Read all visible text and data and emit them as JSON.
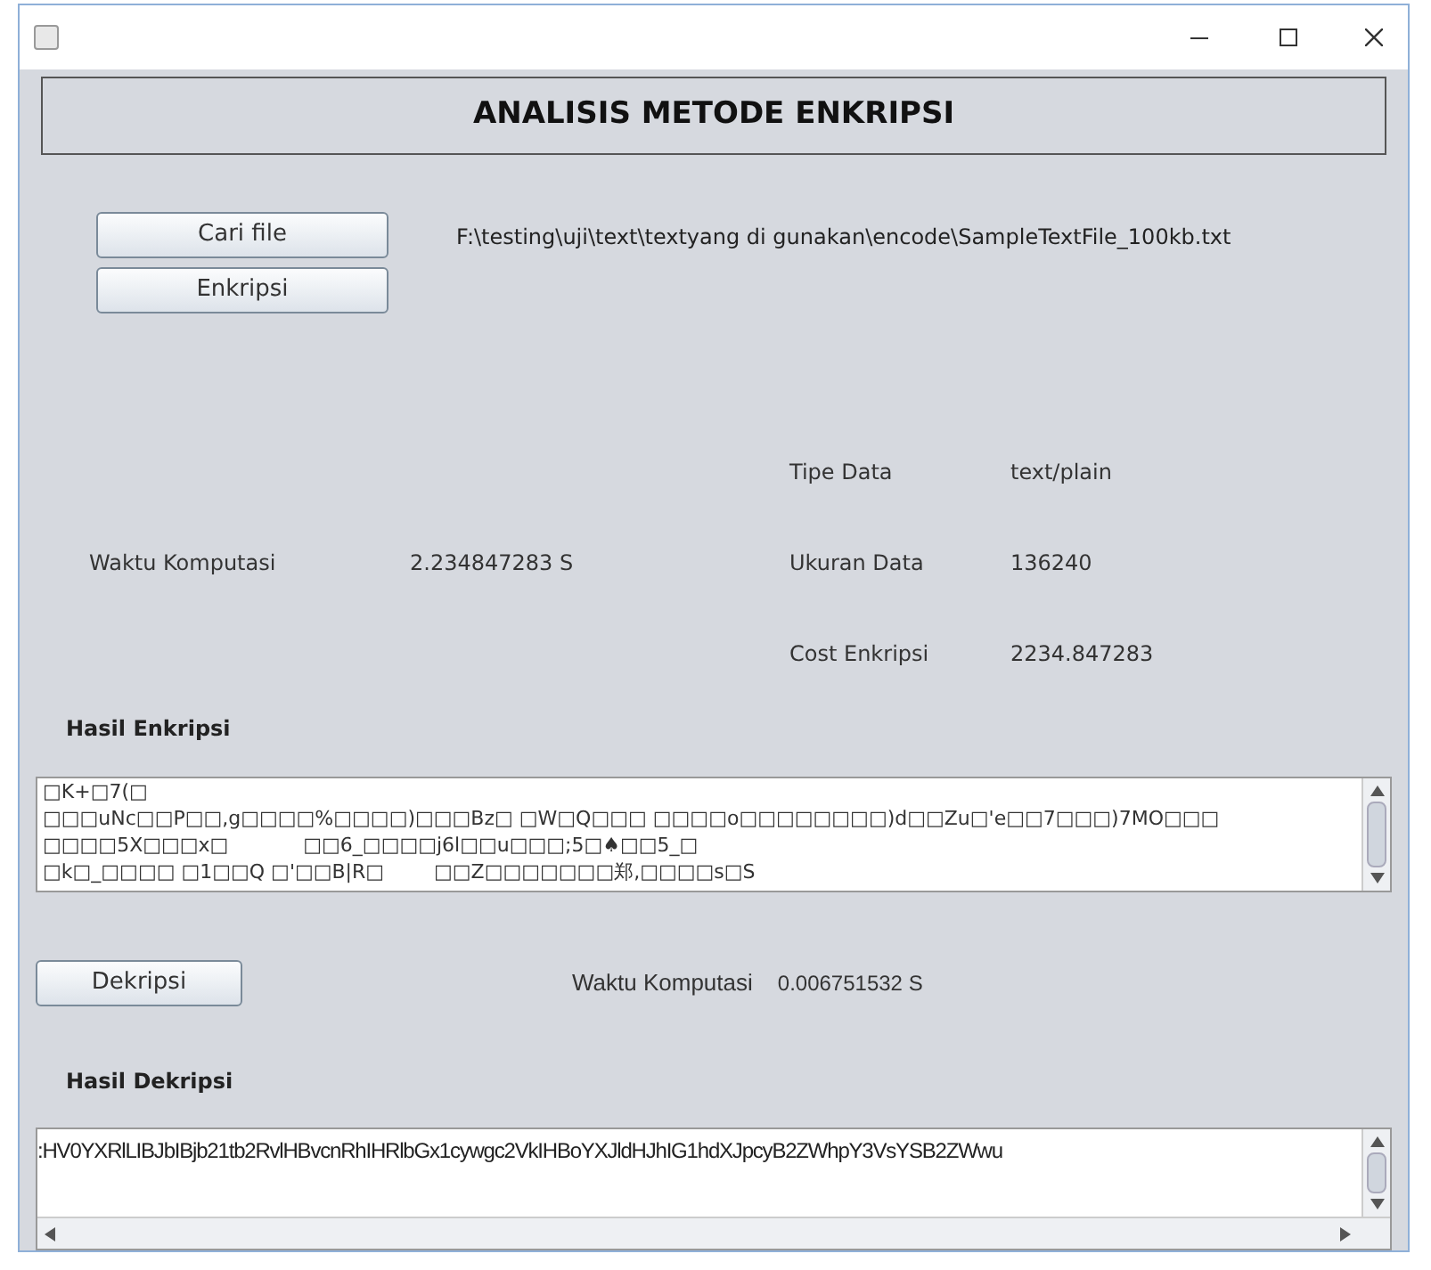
{
  "window": {
    "title_icon": true
  },
  "header": {
    "title": "ANALISIS METODE ENKRIPSI"
  },
  "buttons": {
    "open_file": "Cari file",
    "encrypt": "Enkripsi",
    "decrypt": "Dekripsi"
  },
  "file_path": "F:\\testing\\uji\\text\\textyang di gunakan\\encode\\SampleTextFile_100kb.txt",
  "encryption_time": {
    "label": "Waktu Komputasi",
    "value": "2.234847283 S"
  },
  "info": [
    {
      "label": "Tipe Data",
      "value": "text/plain"
    },
    {
      "label": "Ukuran Data",
      "value": "136240"
    },
    {
      "label": "Cost Enkripsi",
      "value": "2234.847283"
    }
  ],
  "encryption_result": {
    "label": "Hasil Enkripsi",
    "lines": [
      "□K+□7(□",
      "□□□uNc□□P□□,g□□□□%□□□□)□□□Bz□ □W□Q□□□ □□□□o□□□□□□□□)d□□Zu□'e□□7□□□)7MO□□□",
      "□□□□5X□□□x□            □□6_□□□□j6l□□u□□□;5□♠□□5_□",
      "□k□_□□□□ □1□□Q □'□□B|R□        □□Z□□□□□□□郑,□□□□s□S"
    ]
  },
  "decryption_time": {
    "label": "Waktu Komputasi",
    "value": "0.006751532 S"
  },
  "decryption_result": {
    "label": "Hasil Dekripsi",
    "text": ":HV0YXRlLIBJbIBjb21tb2RvlHBvcnRhIHRlbGx1cywgc2VkIHBoYXJldHJhIG1hdXJpcyB2ZWhpY3VsYSB2ZWwu"
  }
}
